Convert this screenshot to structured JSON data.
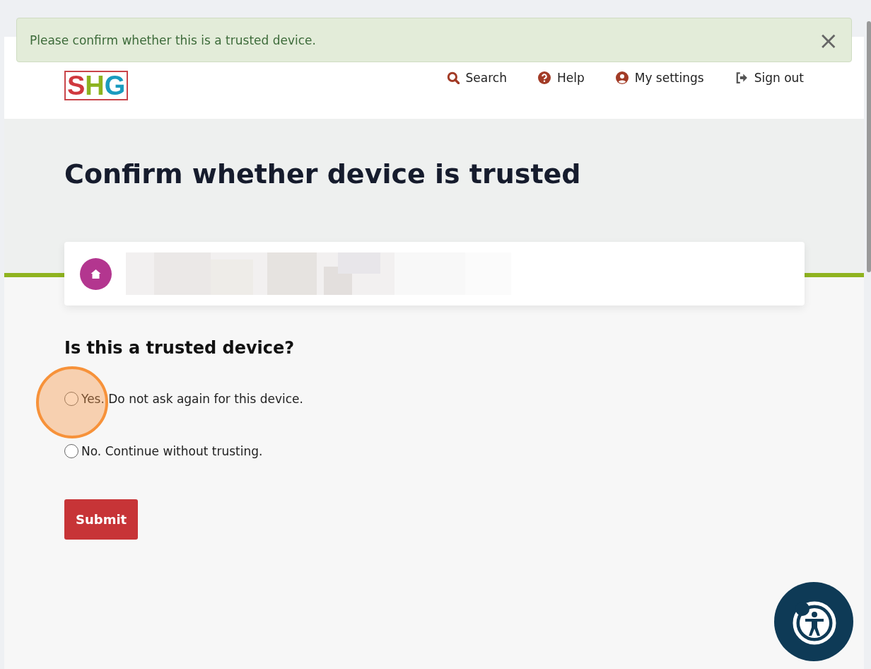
{
  "alert": {
    "message": "Please confirm whether this is a trusted device.",
    "close": "×"
  },
  "logo": {
    "letters": [
      {
        "text": "S",
        "color": "#d0393e"
      },
      {
        "text": "H",
        "color": "#8cb31f"
      },
      {
        "text": "G",
        "color": "#1a9bbf"
      }
    ]
  },
  "nav": [
    {
      "label": "Search"
    },
    {
      "label": "Help"
    },
    {
      "label": "My settings"
    },
    {
      "label": "Sign out"
    }
  ],
  "title": "Confirm whether device is trusted",
  "question": "Is this a trusted device?",
  "options": [
    {
      "label": "Yes. Do not ask again for this device.",
      "selected": false
    },
    {
      "label": "No. Continue without trusting.",
      "selected": false
    }
  ],
  "submit": "Submit"
}
